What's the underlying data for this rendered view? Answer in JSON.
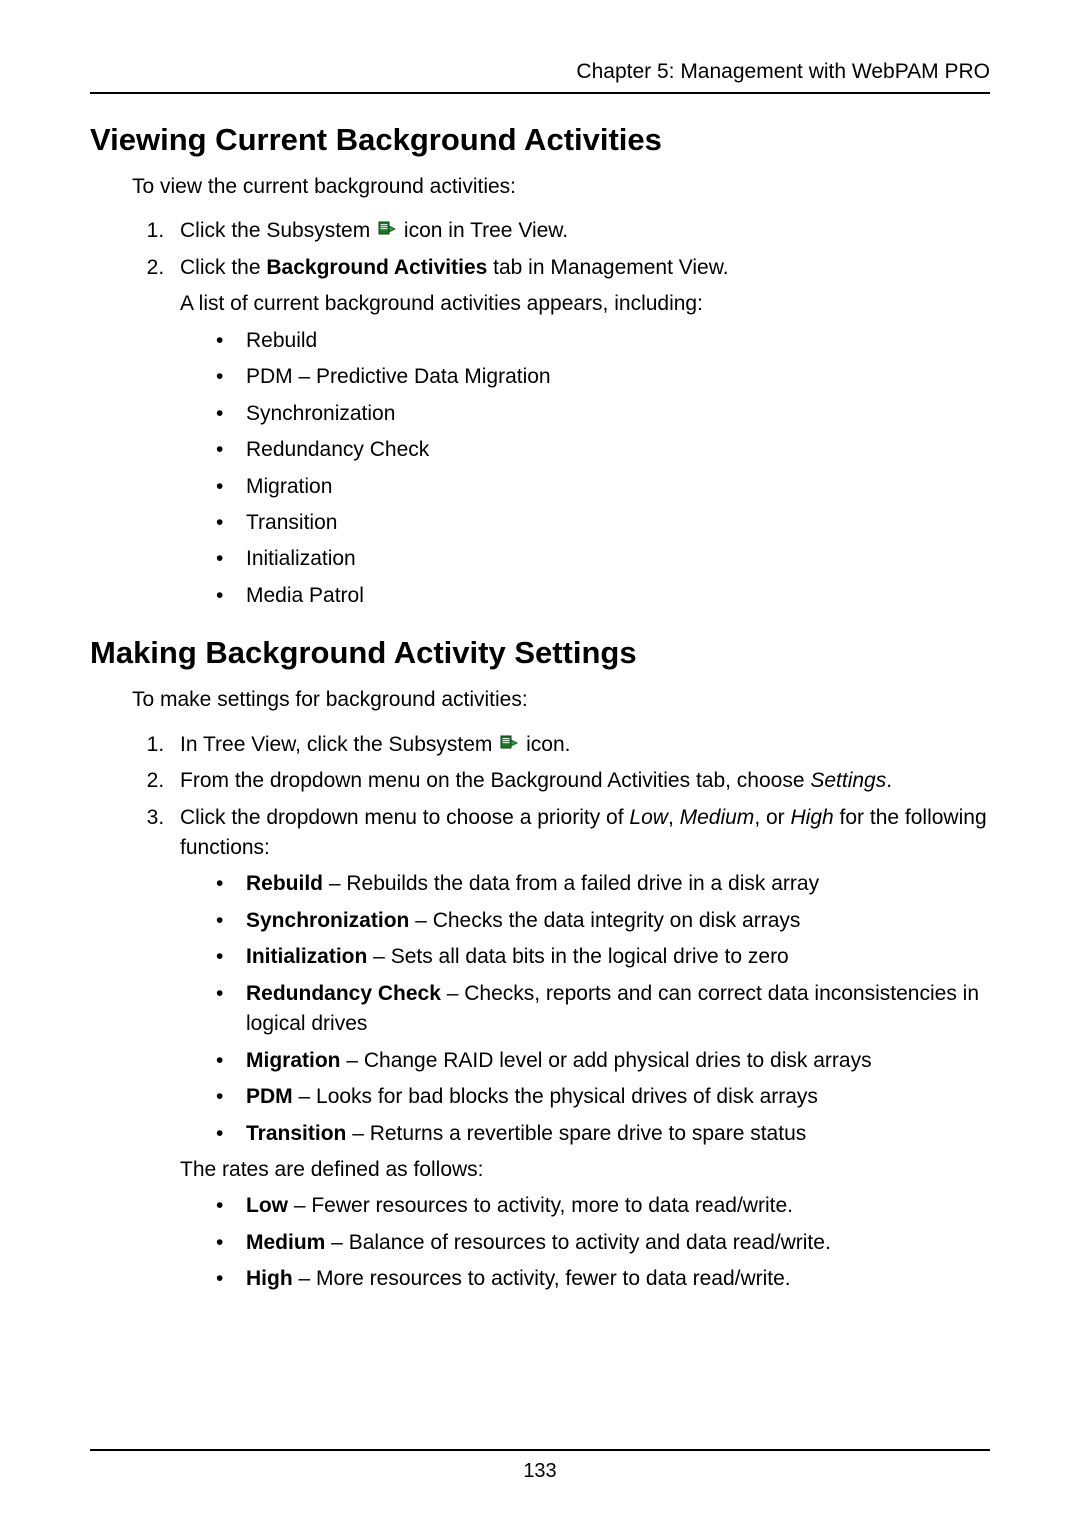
{
  "header": "Chapter 5: Management with WebPAM PRO",
  "page_number": "133",
  "section1": {
    "title": "Viewing Current Background Activities",
    "intro": "To view the current background activities:",
    "step1_a": "Click the Subsystem ",
    "step1_b": " icon in Tree View.",
    "step2_a": "Click the ",
    "step2_bold": "Background Activities",
    "step2_b": " tab in Management View.",
    "step2_sub": "A list of current background activities appears, including:",
    "items": {
      "i0": "Rebuild",
      "i1": "PDM – Predictive Data Migration",
      "i2": "Synchronization",
      "i3": "Redundancy Check",
      "i4": "Migration",
      "i5": "Transition",
      "i6": "Initialization",
      "i7": "Media Patrol"
    }
  },
  "section2": {
    "title": "Making Background Activity Settings",
    "intro": "To make settings for background activities:",
    "step1_a": "In Tree View, click the Subsystem ",
    "step1_b": " icon.",
    "step2_a": "From the dropdown menu on the Background Activities tab, choose ",
    "step2_italic": "Settings",
    "step2_b": ".",
    "step3_a": "Click the dropdown menu to choose a priority of ",
    "step3_low": "Low",
    "step3_sep1": ", ",
    "step3_med": "Medium",
    "step3_sep2": ", or ",
    "step3_high": "High",
    "step3_b": " for the following functions:",
    "functions": {
      "f0_term": "Rebuild",
      "f0_desc": " – Rebuilds the data from a failed drive in a disk array",
      "f1_term": "Synchronization",
      "f1_desc": " – Checks the data integrity on disk arrays",
      "f2_term": "Initialization",
      "f2_desc": " – Sets all data bits in the logical drive to zero",
      "f3_term": "Redundancy Check",
      "f3_desc": " – Checks, reports and can correct data inconsistencies in logical drives",
      "f4_term": "Migration",
      "f4_desc": " – Change RAID level or add physical dries to disk arrays",
      "f5_term": "PDM",
      "f5_desc": " – Looks for bad blocks the physical drives of disk arrays",
      "f6_term": "Transition",
      "f6_desc": " – Returns a revertible spare drive to spare status"
    },
    "rates_intro": "The rates are defined as follows:",
    "rates": {
      "r0_term": "Low",
      "r0_desc": " – Fewer resources to activity, more to data read/write.",
      "r1_term": "Medium",
      "r1_desc": " – Balance of resources to activity and data read/write.",
      "r2_term": "High",
      "r2_desc": " – More resources to activity, fewer to data read/write."
    }
  }
}
